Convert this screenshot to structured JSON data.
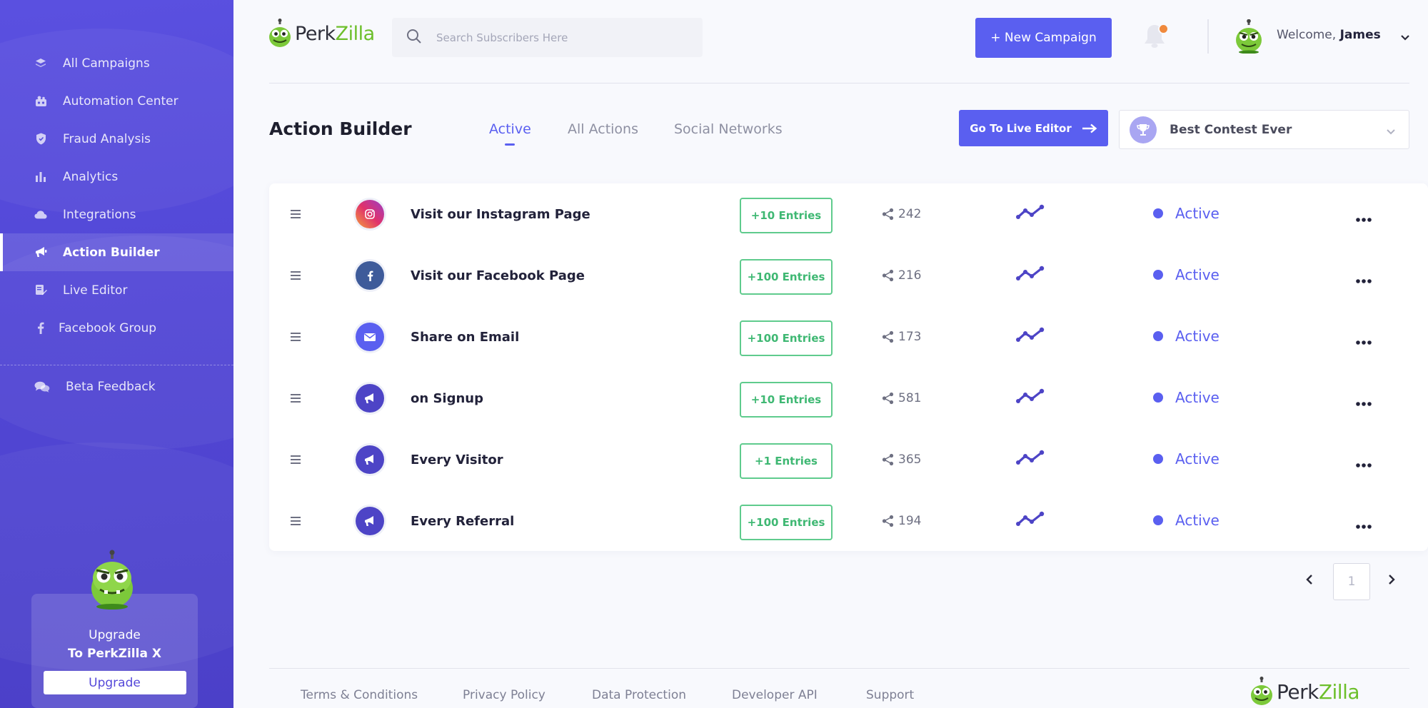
{
  "brand": {
    "name_part1": "Perk",
    "name_part2": "Zilla",
    "accent": "#5A5FF0",
    "green": "#6CBF2A"
  },
  "sidebar": {
    "items": [
      {
        "label": "All Campaigns",
        "icon": "layers-icon"
      },
      {
        "label": "Automation Center",
        "icon": "automation-icon"
      },
      {
        "label": "Fraud Analysis",
        "icon": "shield-icon"
      },
      {
        "label": "Analytics",
        "icon": "bar-chart-icon"
      },
      {
        "label": "Integrations",
        "icon": "cloud-icon"
      },
      {
        "label": "Action Builder",
        "icon": "megaphone-icon",
        "active": true
      },
      {
        "label": "Live Editor",
        "icon": "edit-icon"
      },
      {
        "label": "Facebook Group",
        "icon": "facebook-icon"
      }
    ],
    "beta": {
      "label": "Beta Feedback",
      "icon": "chat-icon"
    },
    "upgrade": {
      "line1": "Upgrade",
      "line2": "To PerkZilla X",
      "button": "Upgrade"
    }
  },
  "header": {
    "search_placeholder": "Search Subscribers Here",
    "new_campaign": "+ New Campaign",
    "welcome_prefix": "Welcome, ",
    "user_name": "James"
  },
  "toolbar": {
    "title": "Action Builder",
    "tabs": [
      {
        "label": "Active",
        "active": true
      },
      {
        "label": "All Actions"
      },
      {
        "label": "Social Networks"
      }
    ],
    "live_editor": "Go To Live Editor",
    "contest": "Best Contest Ever"
  },
  "actions": [
    {
      "name": "Visit our Instagram Page",
      "entries": "+10 Entries",
      "shares": "242",
      "status": "Active",
      "icon": "instagram-icon"
    },
    {
      "name": "Visit our Facebook Page",
      "entries": "+100 Entries",
      "shares": "216",
      "status": "Active",
      "icon": "facebook-icon"
    },
    {
      "name": "Share on Email",
      "entries": "+100 Entries",
      "shares": "173",
      "status": "Active",
      "icon": "email-icon"
    },
    {
      "name": "on Signup",
      "entries": "+10 Entries",
      "shares": "581",
      "status": "Active",
      "icon": "megaphone-icon"
    },
    {
      "name": "Every Visitor",
      "entries": "+1 Entries",
      "shares": "365",
      "status": "Active",
      "icon": "megaphone-icon"
    },
    {
      "name": "Every Referral",
      "entries": "+100 Entries",
      "shares": "194",
      "status": "Active",
      "icon": "megaphone-icon"
    }
  ],
  "pagination": {
    "current": "1"
  },
  "footer": {
    "links": [
      "Terms & Conditions",
      "Privacy Policy",
      "Data Protection",
      "Developer API",
      "Support"
    ]
  }
}
